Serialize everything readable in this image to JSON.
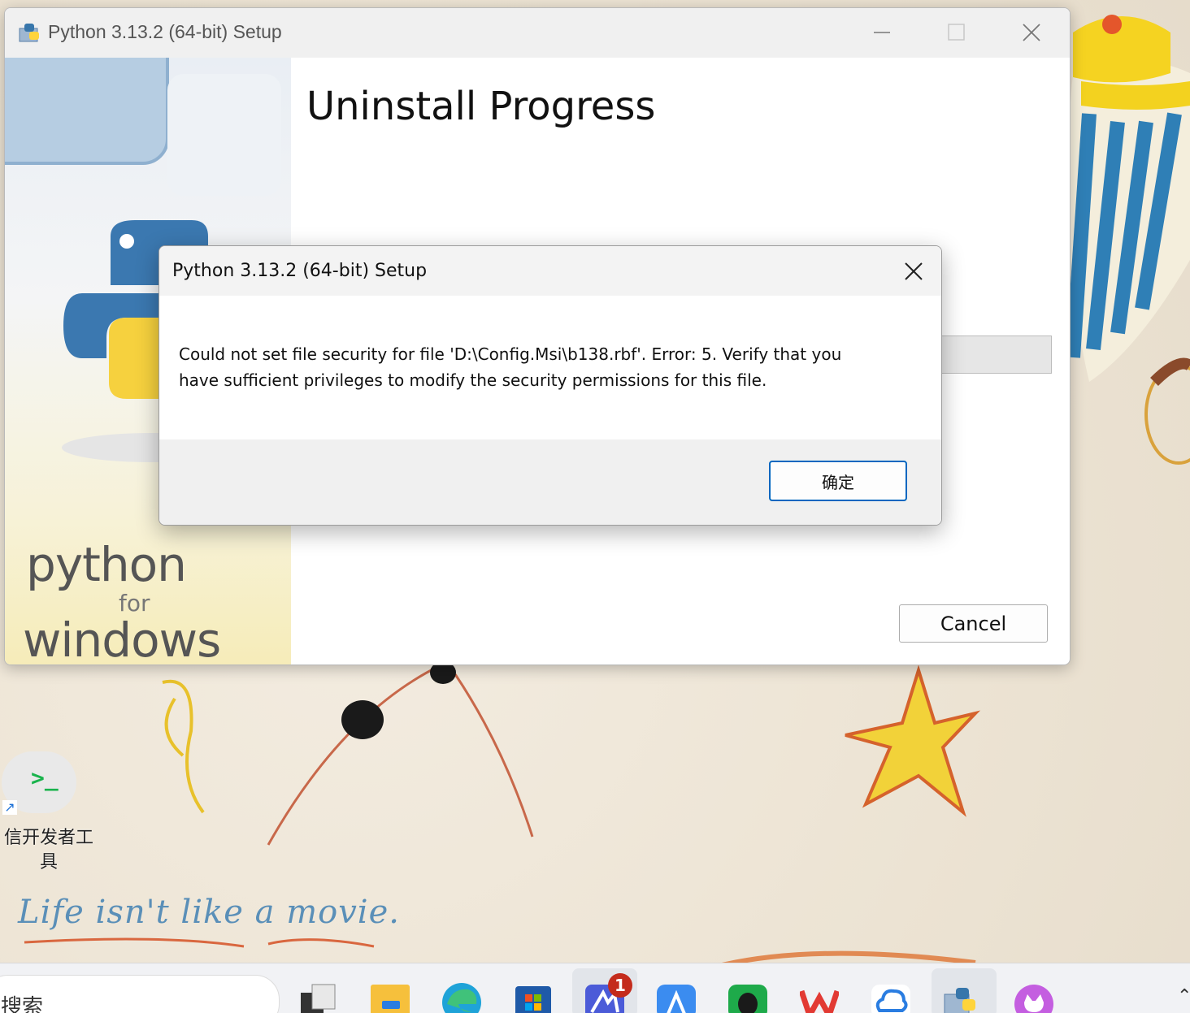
{
  "setup_window": {
    "title": "Python 3.13.2 (64-bit) Setup",
    "heading": "Uninstall Progress",
    "cancel_label": "Cancel",
    "brand": {
      "line1": "python",
      "line2": "for",
      "line3": "windows"
    }
  },
  "error_dialog": {
    "title": "Python 3.13.2 (64-bit) Setup",
    "message_line1": "Could not set file security for file 'D:\\Config.Msi\\b138.rbf'. Error: 5.  Verify that you",
    "message_line2": "have sufficient privileges to modify the security permissions for this file.",
    "ok_label": "确定"
  },
  "desktop": {
    "shortcut_label_line1": "信开发者工",
    "shortcut_label_line2": "具",
    "wallpaper_text": "Life isn't like a movie."
  },
  "taskbar": {
    "search_text": "搜索",
    "notification_badge": "1",
    "icons": [
      "task-view-icon",
      "file-explorer-icon",
      "edge-icon",
      "store-icon",
      "mail-app-icon",
      "app-store-icon",
      "evernote-icon",
      "wps-icon",
      "cloud-drive-icon",
      "python-setup-icon",
      "cat-app-icon"
    ]
  },
  "colors": {
    "accent": "#0067c0",
    "python_blue": "#3776ab",
    "python_yellow": "#ffd43b",
    "badge_red": "#c42b1c"
  }
}
